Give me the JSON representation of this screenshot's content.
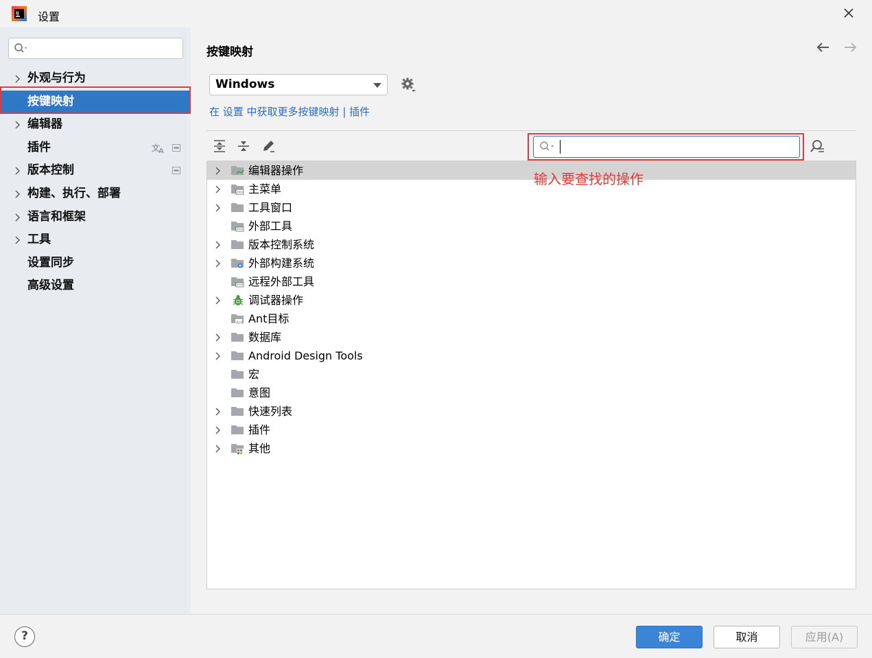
{
  "window": {
    "title": "设置"
  },
  "sidebar": {
    "items": [
      {
        "label": "外观与行为",
        "expandable": true
      },
      {
        "label": "按键映射",
        "expandable": false,
        "selected": true
      },
      {
        "label": "编辑器",
        "expandable": true
      },
      {
        "label": "插件",
        "expandable": false
      },
      {
        "label": "版本控制",
        "expandable": true
      },
      {
        "label": "构建、执行、部署",
        "expandable": true
      },
      {
        "label": "语言和框架",
        "expandable": true
      },
      {
        "label": "工具",
        "expandable": true
      },
      {
        "label": "设置同步",
        "expandable": false
      },
      {
        "label": "高级设置",
        "expandable": false
      }
    ]
  },
  "main": {
    "title": "按键映射",
    "keymap_value": "Windows",
    "link": {
      "prefix": "在 设置 中获取更多按键映射",
      "separator": " | ",
      "plugins": "插件"
    },
    "annotation": "输入要查找的操作",
    "tree": [
      {
        "label": "编辑器操作",
        "expandable": true,
        "icon": "folder-editor-icon"
      },
      {
        "label": "主菜单",
        "expandable": true,
        "icon": "folder-menu-icon"
      },
      {
        "label": "工具窗口",
        "expandable": true,
        "icon": "folder-icon"
      },
      {
        "label": "外部工具",
        "expandable": false,
        "icon": "folder-tools-icon"
      },
      {
        "label": "版本控制系统",
        "expandable": true,
        "icon": "folder-icon"
      },
      {
        "label": "外部构建系统",
        "expandable": true,
        "icon": "folder-build-icon"
      },
      {
        "label": "远程外部工具",
        "expandable": false,
        "icon": "folder-tools-icon"
      },
      {
        "label": "调试器操作",
        "expandable": true,
        "icon": "bug-icon"
      },
      {
        "label": "Ant目标",
        "expandable": false,
        "icon": "folder-ant-icon"
      },
      {
        "label": "数据库",
        "expandable": true,
        "icon": "folder-icon"
      },
      {
        "label": "Android Design Tools",
        "expandable": true,
        "icon": "folder-icon"
      },
      {
        "label": "宏",
        "expandable": false,
        "icon": "folder-icon"
      },
      {
        "label": "意图",
        "expandable": false,
        "icon": "folder-icon"
      },
      {
        "label": "快速列表",
        "expandable": true,
        "icon": "folder-icon"
      },
      {
        "label": "插件",
        "expandable": true,
        "icon": "folder-icon"
      },
      {
        "label": "其他",
        "expandable": true,
        "icon": "folder-other-icon"
      }
    ]
  },
  "footer": {
    "help": "?",
    "ok": "确定",
    "cancel": "取消",
    "apply": "应用(A)"
  },
  "colors": {
    "accent": "#2f78c5",
    "highlight": "#e53935",
    "link": "#2a6dbf"
  }
}
